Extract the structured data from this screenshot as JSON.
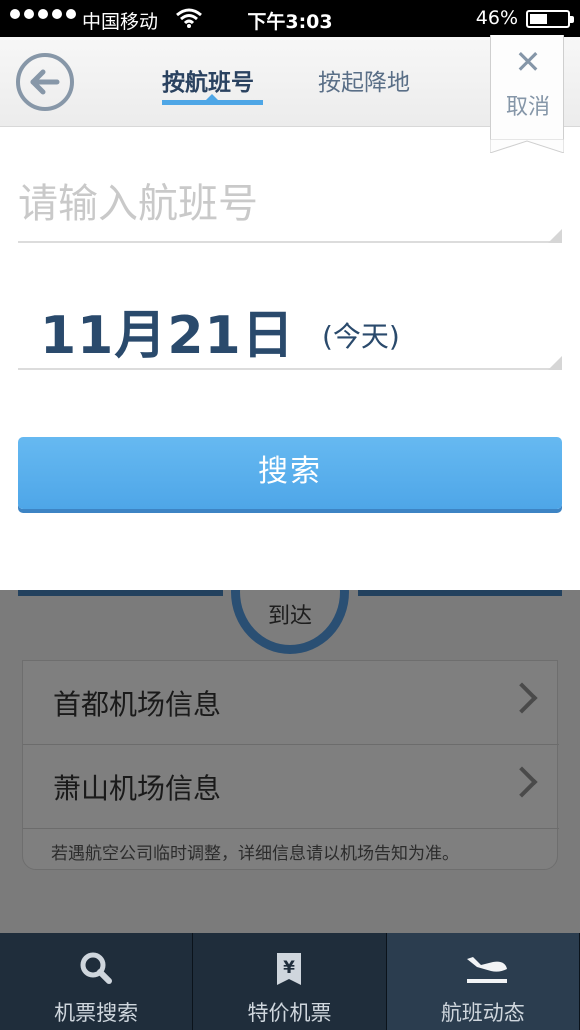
{
  "status_bar": {
    "carrier": "中国移动",
    "time": "下午3:03",
    "battery": "46%",
    "battery_level": 0.46
  },
  "modal": {
    "tabs": [
      {
        "label": "按航班号",
        "active": true
      },
      {
        "label": "按起降地",
        "active": false
      }
    ],
    "cancel_label": "取消",
    "flight_input": {
      "placeholder": "请输入航班号",
      "value": ""
    },
    "date": {
      "main": "11月21日",
      "sub": "(今天)"
    },
    "search_label": "搜索"
  },
  "background_page": {
    "circle_label": "到达",
    "rows": [
      {
        "label": "首都机场信息"
      },
      {
        "label": "萧山机场信息"
      }
    ],
    "note": "若遇航空公司临时调整，详细信息请以机场告知为准。"
  },
  "tab_bar": {
    "tabs": [
      {
        "label": "机票搜索",
        "icon": "search-icon",
        "active": false
      },
      {
        "label": "特价机票",
        "icon": "yen-ticket-icon",
        "active": false
      },
      {
        "label": "航班动态",
        "icon": "plane-landing-icon",
        "active": true
      }
    ]
  },
  "colors": {
    "accent": "#4ea6e6",
    "header_text": "#2a4260",
    "tab_bar_bg": "#1f2d3b"
  }
}
